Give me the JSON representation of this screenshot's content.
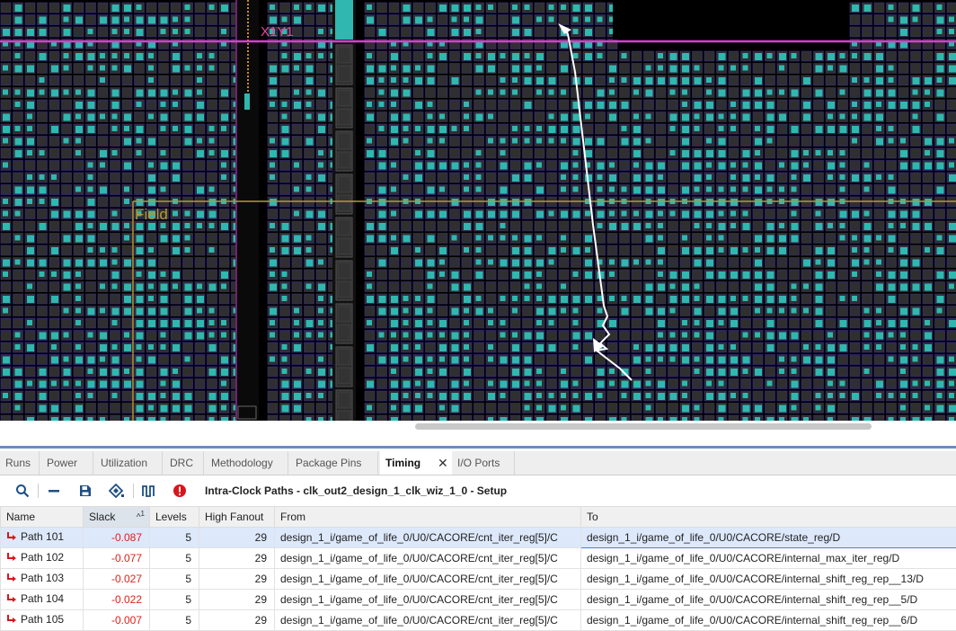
{
  "device": {
    "region_label": "X1Y1",
    "pblock_label": "Field",
    "colors": {
      "background": "#000000",
      "tile_grid": "#3b2f8a",
      "cell_fill": "#2f2f2f",
      "cell_used": "#2fb7b0",
      "region_boundary": "#d43fd4",
      "pblock": "#b89a2a",
      "timing_path": "#ffffff"
    }
  },
  "tabs": {
    "items": [
      {
        "label": "Runs",
        "active": false
      },
      {
        "label": "Power",
        "active": false
      },
      {
        "label": "Utilization",
        "active": false
      },
      {
        "label": "DRC",
        "active": false
      },
      {
        "label": "Methodology",
        "active": false
      },
      {
        "label": "Package Pins",
        "active": false
      },
      {
        "label": "Timing",
        "active": true
      },
      {
        "label": "I/O Ports",
        "active": false
      }
    ],
    "close_glyph": "✕"
  },
  "toolbar": {
    "buttons": [
      "search-icon",
      "collapse-icon",
      "save-icon",
      "filter-icon",
      "waveform-icon",
      "error-icon"
    ],
    "title": "Intra-Clock Paths - clk_out2_design_1_clk_wiz_1_0 - Setup"
  },
  "table": {
    "columns": [
      "Name",
      "Slack",
      "Levels",
      "High Fanout",
      "From",
      "To"
    ],
    "sort": {
      "column": "Slack",
      "indicator": "^",
      "order": "1"
    },
    "rows": [
      {
        "name": "Path 101",
        "slack": "-0.087",
        "levels": "5",
        "fanout": "29",
        "from": "design_1_i/game_of_life_0/U0/CACORE/cnt_iter_reg[5]/C",
        "to": "design_1_i/game_of_life_0/U0/CACORE/state_reg/D",
        "selected": true
      },
      {
        "name": "Path 102",
        "slack": "-0.077",
        "levels": "5",
        "fanout": "29",
        "from": "design_1_i/game_of_life_0/U0/CACORE/cnt_iter_reg[5]/C",
        "to": "design_1_i/game_of_life_0/U0/CACORE/internal_max_iter_reg/D",
        "selected": false
      },
      {
        "name": "Path 103",
        "slack": "-0.027",
        "levels": "5",
        "fanout": "29",
        "from": "design_1_i/game_of_life_0/U0/CACORE/cnt_iter_reg[5]/C",
        "to": "design_1_i/game_of_life_0/U0/CACORE/internal_shift_reg_rep__13/D",
        "selected": false
      },
      {
        "name": "Path 104",
        "slack": "-0.022",
        "levels": "5",
        "fanout": "29",
        "from": "design_1_i/game_of_life_0/U0/CACORE/cnt_iter_reg[5]/C",
        "to": "design_1_i/game_of_life_0/U0/CACORE/internal_shift_reg_rep__5/D",
        "selected": false
      },
      {
        "name": "Path 105",
        "slack": "-0.007",
        "levels": "5",
        "fanout": "29",
        "from": "design_1_i/game_of_life_0/U0/CACORE/cnt_iter_reg[5]/C",
        "to": "design_1_i/game_of_life_0/U0/CACORE/internal_shift_reg_rep__6/D",
        "selected": false
      }
    ]
  }
}
